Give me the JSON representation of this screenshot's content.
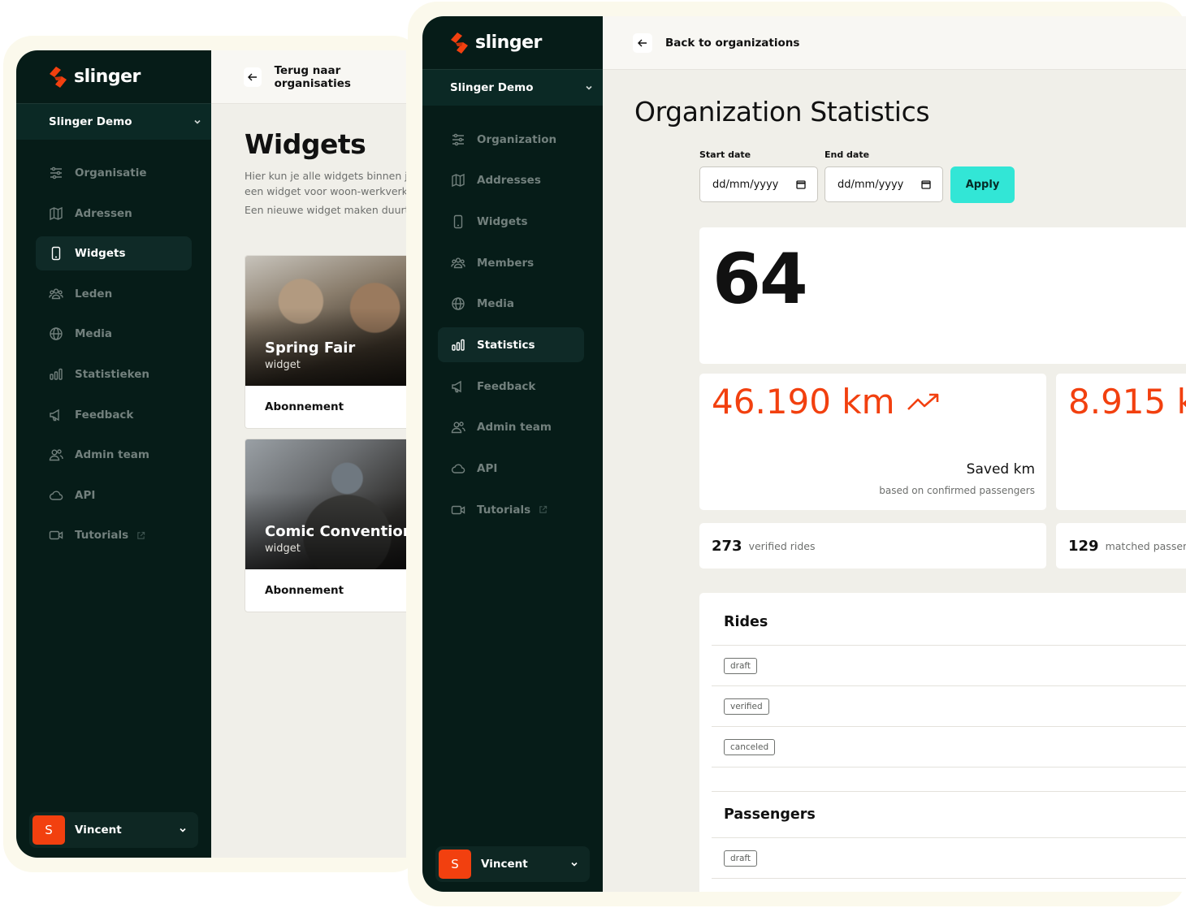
{
  "brand": {
    "name": "slinger",
    "accent": "#f2400f",
    "dark": "#061c18",
    "cta": "#32e6d6"
  },
  "left_window": {
    "org": "Slinger Demo",
    "nav": [
      {
        "label": "Organisatie",
        "icon": "sliders-icon",
        "active": false
      },
      {
        "label": "Adressen",
        "icon": "map-icon",
        "active": false
      },
      {
        "label": "Widgets",
        "icon": "smartphone-icon",
        "active": true
      },
      {
        "label": "Leden",
        "icon": "users-icon",
        "active": false
      },
      {
        "label": "Media",
        "icon": "globe-icon",
        "active": false
      },
      {
        "label": "Statistieken",
        "icon": "bar-chart-icon",
        "active": false
      },
      {
        "label": "Feedback",
        "icon": "megaphone-icon",
        "active": false
      },
      {
        "label": "Admin team",
        "icon": "admin-team-icon",
        "active": false
      },
      {
        "label": "API",
        "icon": "cloud-icon",
        "active": false
      },
      {
        "label": "Tutorials",
        "icon": "video-icon",
        "active": false,
        "external": true
      }
    ],
    "user": {
      "initial": "S",
      "name": "Vincent"
    },
    "back_label": "Terug naar organisaties",
    "title": "Widgets",
    "desc_line1": "Hier kun je alle widgets binnen j",
    "desc_line2": "een widget voor woon-werkverk",
    "desc_line3": "Een nieuwe widget maken duurt",
    "widgets": [
      {
        "name": "Spring Fair",
        "sub": "widget",
        "footer": "Abonnement"
      },
      {
        "name": "Comic Convention",
        "sub": "widget",
        "footer": "Abonnement"
      }
    ]
  },
  "right_window": {
    "org": "Slinger Demo",
    "nav": [
      {
        "label": "Organization",
        "icon": "sliders-icon",
        "active": false
      },
      {
        "label": "Addresses",
        "icon": "map-icon",
        "active": false
      },
      {
        "label": "Widgets",
        "icon": "smartphone-icon",
        "active": false
      },
      {
        "label": "Members",
        "icon": "users-icon",
        "active": false
      },
      {
        "label": "Media",
        "icon": "globe-icon",
        "active": false
      },
      {
        "label": "Statistics",
        "icon": "bar-chart-icon",
        "active": true
      },
      {
        "label": "Feedback",
        "icon": "megaphone-icon",
        "active": false
      },
      {
        "label": "Admin team",
        "icon": "admin-team-icon",
        "active": false
      },
      {
        "label": "API",
        "icon": "cloud-icon",
        "active": false
      },
      {
        "label": "Tutorials",
        "icon": "video-icon",
        "active": false,
        "external": true
      }
    ],
    "user": {
      "initial": "S",
      "name": "Vincent"
    },
    "back_label": "Back to organizations",
    "title": "Organization Statistics",
    "start_label": "Start date",
    "end_label": "End date",
    "date_placeholder": "dd/mm/yyyy",
    "apply_label": "Apply",
    "big_number": "64",
    "saved_km": {
      "value": "46.190 km",
      "label": "Saved km",
      "sub": "based on confirmed passengers"
    },
    "second_km": {
      "value": "8.915 k"
    },
    "verified_rides": {
      "num": "273",
      "label": "verified rides"
    },
    "matched": {
      "num": "129",
      "label": "matched passeng"
    },
    "rides": {
      "title": "Rides",
      "statuses": [
        "draft",
        "verified",
        "canceled"
      ]
    },
    "passengers": {
      "title": "Passengers",
      "statuses": [
        "draft"
      ]
    }
  }
}
